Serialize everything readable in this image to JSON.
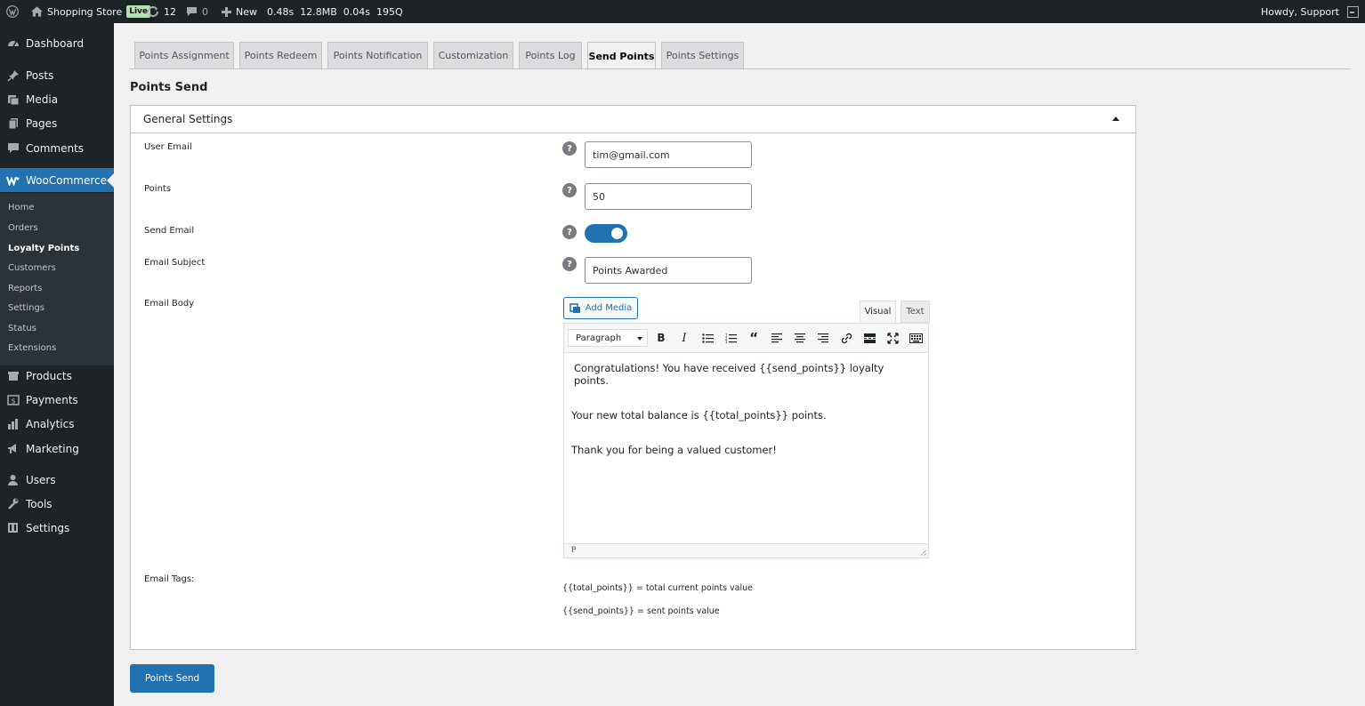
{
  "admin_bar": {
    "site_name": "Shopping Store",
    "live_badge": "Live",
    "updates_count": "12",
    "comments_count": "0",
    "new_label": "New",
    "perf_stats": "0.48s  12.8MB  0.04s  195Q",
    "greeting": "Howdy, Support"
  },
  "sidebar": {
    "top_items": [
      {
        "label": "Dashboard",
        "icon": "dashboard-icon"
      },
      {
        "label": "Posts",
        "icon": "pin-icon"
      },
      {
        "label": "Media",
        "icon": "media-icon"
      },
      {
        "label": "Pages",
        "icon": "pages-icon"
      },
      {
        "label": "Comments",
        "icon": "comment-icon"
      },
      {
        "label": "WooCommerce",
        "icon": "woo-icon"
      }
    ],
    "woo_submenu": [
      "Home",
      "Orders",
      "Loyalty Points",
      "Customers",
      "Reports",
      "Settings",
      "Status",
      "Extensions"
    ],
    "bottom_items": [
      {
        "label": "Products",
        "icon": "products-icon"
      },
      {
        "label": "Payments",
        "icon": "payments-icon"
      },
      {
        "label": "Analytics",
        "icon": "analytics-icon"
      },
      {
        "label": "Marketing",
        "icon": "marketing-icon"
      },
      {
        "label": "Users",
        "icon": "users-icon"
      },
      {
        "label": "Tools",
        "icon": "tools-icon"
      },
      {
        "label": "Settings",
        "icon": "settings-icon"
      }
    ]
  },
  "tabs": [
    "Points Assignment",
    "Points Redeem",
    "Points Notification",
    "Customization",
    "Points Log",
    "Send Points",
    "Points Settings"
  ],
  "active_tab": "Send Points",
  "page_title": "Points Send",
  "panel": {
    "title": "General Settings",
    "fields": {
      "user_email": {
        "label": "User Email",
        "value": "tim@gmail.com"
      },
      "points": {
        "label": "Points",
        "value": "50"
      },
      "send_email": {
        "label": "Send Email",
        "enabled": true
      },
      "email_subject": {
        "label": "Email Subject",
        "value": "Points Awarded"
      },
      "email_body": {
        "label": "Email Body"
      }
    },
    "editor": {
      "add_media_label": "Add Media",
      "visual_tab": "Visual",
      "text_tab": "Text",
      "format_select": "Paragraph",
      "paragraphs": [
        "Congratulations! You have received {{send_points}} loyalty points.",
        "Your new total balance is {{total_points}} points.",
        "Thank you for being a valued customer!"
      ],
      "status_path": "P"
    },
    "email_tags_label": "Email Tags:",
    "email_tags": [
      "{{total_points}} = total current points value",
      "{{send_points}} = sent points value"
    ]
  },
  "submit_label": "Points Send",
  "colors": {
    "accent": "#2271b1",
    "admin_bar": "#1d2327",
    "background": "#f0f0f1"
  }
}
